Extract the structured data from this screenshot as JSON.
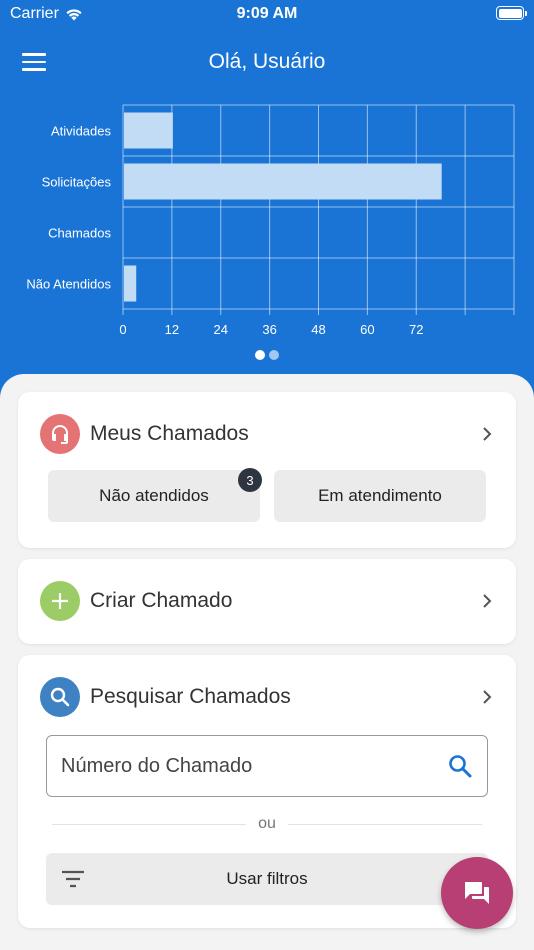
{
  "status_bar": {
    "carrier": "Carrier",
    "time": "9:09 AM"
  },
  "header": {
    "title": "Olá, Usuário"
  },
  "chart_data": {
    "type": "bar",
    "orientation": "horizontal",
    "categories": [
      "Atividades",
      "Solicitações",
      "Chamados",
      "Não Atendidos"
    ],
    "values": [
      12,
      78,
      0,
      3
    ],
    "x_ticks": [
      "0",
      "12",
      "24",
      "36",
      "48",
      "60",
      "72"
    ],
    "xlim": [
      0,
      96
    ],
    "grid": true,
    "bar_color": "#c3dcf5"
  },
  "pager": {
    "pages": 2,
    "active": 0
  },
  "cards": {
    "meus_chamados": {
      "title": "Meus Chamados",
      "icon": "headset-icon",
      "icon_color": "#e57373",
      "buttons": {
        "nao_atendidos": "Não atendidos",
        "em_atendimento": "Em atendimento"
      },
      "badge": "3"
    },
    "criar_chamado": {
      "title": "Criar Chamado",
      "icon": "plus-icon",
      "icon_color": "#9ccc65"
    },
    "pesquisar_chamados": {
      "title": "Pesquisar Chamados",
      "icon": "search-icon",
      "icon_color": "#3f82c4",
      "search_placeholder": "Número do Chamado",
      "search_value": "",
      "divider_text": "ou",
      "filters_label": "Usar filtros"
    }
  },
  "fab": {
    "icon": "chat-icon",
    "color": "#b73f73"
  },
  "colors": {
    "primary": "#1a74d6",
    "background": "#f3f3f3"
  }
}
